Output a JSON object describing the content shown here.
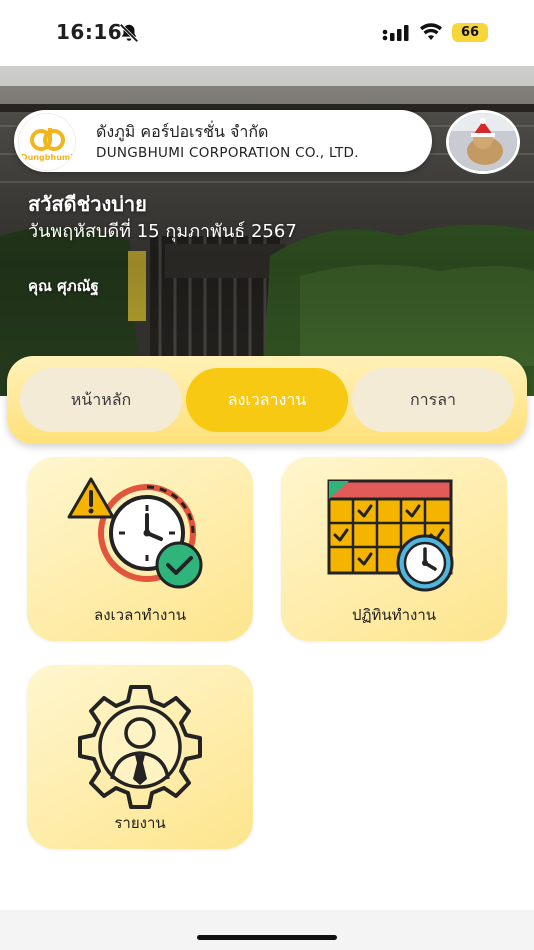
{
  "status_bar": {
    "time": "16:16",
    "battery": "66",
    "icons": [
      "bell-slash-icon",
      "cellular-signal-icon",
      "wifi-icon",
      "battery-icon"
    ]
  },
  "header": {
    "company_name_th": "ดังภูมิ คอร์ปอเรชั่น จำกัด",
    "company_name_en": "DUNGBHUMI CORPORATION CO., LTD.",
    "logo_text": "Dungbhumi",
    "greeting": "สวัสดีช่วงบ่าย",
    "date": "วันพฤหัสบดีที่ 15 กุมภาพันธ์ 2567",
    "user_name": "คุณ ศุภณัฐ"
  },
  "tabs": [
    {
      "label": "หน้าหลัก",
      "active": false
    },
    {
      "label": "ลงเวลางาน",
      "active": true
    },
    {
      "label": "การลา",
      "active": false
    }
  ],
  "menu_cards": [
    {
      "label": "ลงเวลาทำงาน",
      "icon": "clock-alert-check-icon"
    },
    {
      "label": "ปฏิทินทำงาน",
      "icon": "calendar-clock-icon"
    },
    {
      "label": "รายงาน",
      "icon": "gear-person-icon"
    }
  ],
  "colors": {
    "accent": "#f7c913",
    "tab_bar": "#ffe07a",
    "card_bg": "#fde58d",
    "inactive_tab": "#f3ebd6"
  }
}
